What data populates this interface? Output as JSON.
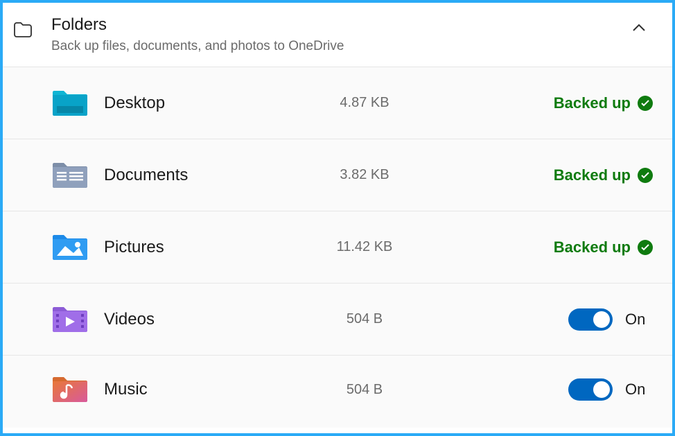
{
  "header": {
    "title": "Folders",
    "subtitle": "Back up files, documents, and photos to OneDrive"
  },
  "colors": {
    "accent": "#0067c0",
    "success": "#0f7b0f",
    "frame": "#2baaf6"
  },
  "folders": [
    {
      "icon": "desktop",
      "name": "Desktop",
      "size": "4.87 KB",
      "status_type": "backed_up",
      "status_label": "Backed up"
    },
    {
      "icon": "documents",
      "name": "Documents",
      "size": "3.82 KB",
      "status_type": "backed_up",
      "status_label": "Backed up"
    },
    {
      "icon": "pictures",
      "name": "Pictures",
      "size": "11.42 KB",
      "status_type": "backed_up",
      "status_label": "Backed up"
    },
    {
      "icon": "videos",
      "name": "Videos",
      "size": "504 B",
      "status_type": "toggle_on",
      "status_label": "On"
    },
    {
      "icon": "music",
      "name": "Music",
      "size": "504 B",
      "status_type": "toggle_on",
      "status_label": "On"
    }
  ]
}
